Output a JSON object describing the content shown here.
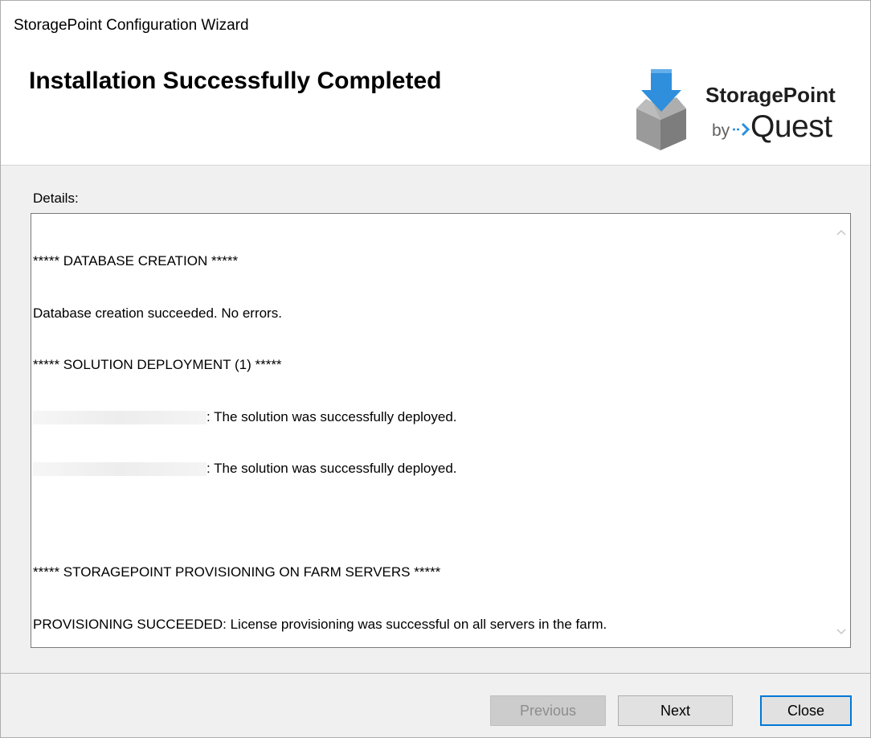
{
  "window": {
    "title": "StoragePoint Configuration Wizard"
  },
  "header": {
    "heading": "Installation Successfully Completed",
    "logo": {
      "product": "StoragePoint",
      "by": "by",
      "brand": "Quest",
      "icon": "box-download-icon",
      "arrow_color": "#2f8fdc",
      "box_color": "#8c8c8c"
    }
  },
  "details": {
    "label": "Details:",
    "lines": [
      "***** DATABASE CREATION *****",
      "Database creation succeeded. No errors.",
      "***** SOLUTION DEPLOYMENT (1) *****",
      ": The solution was successfully deployed.",
      ": The solution was successfully deployed.",
      "",
      "***** STORAGEPOINT PROVISIONING ON FARM SERVERS *****",
      "PROVISIONING SUCCEEDED: License provisioning was successful on all servers in the farm."
    ],
    "scrollbar": {
      "up_icon": "chevron-up-icon",
      "down_icon": "chevron-down-icon"
    }
  },
  "buttons": {
    "previous": "Previous",
    "next": "Next",
    "close": "Close"
  },
  "colors": {
    "default_button_border": "#0078d7",
    "window_background": "#f0f0f0",
    "header_background": "#ffffff"
  }
}
